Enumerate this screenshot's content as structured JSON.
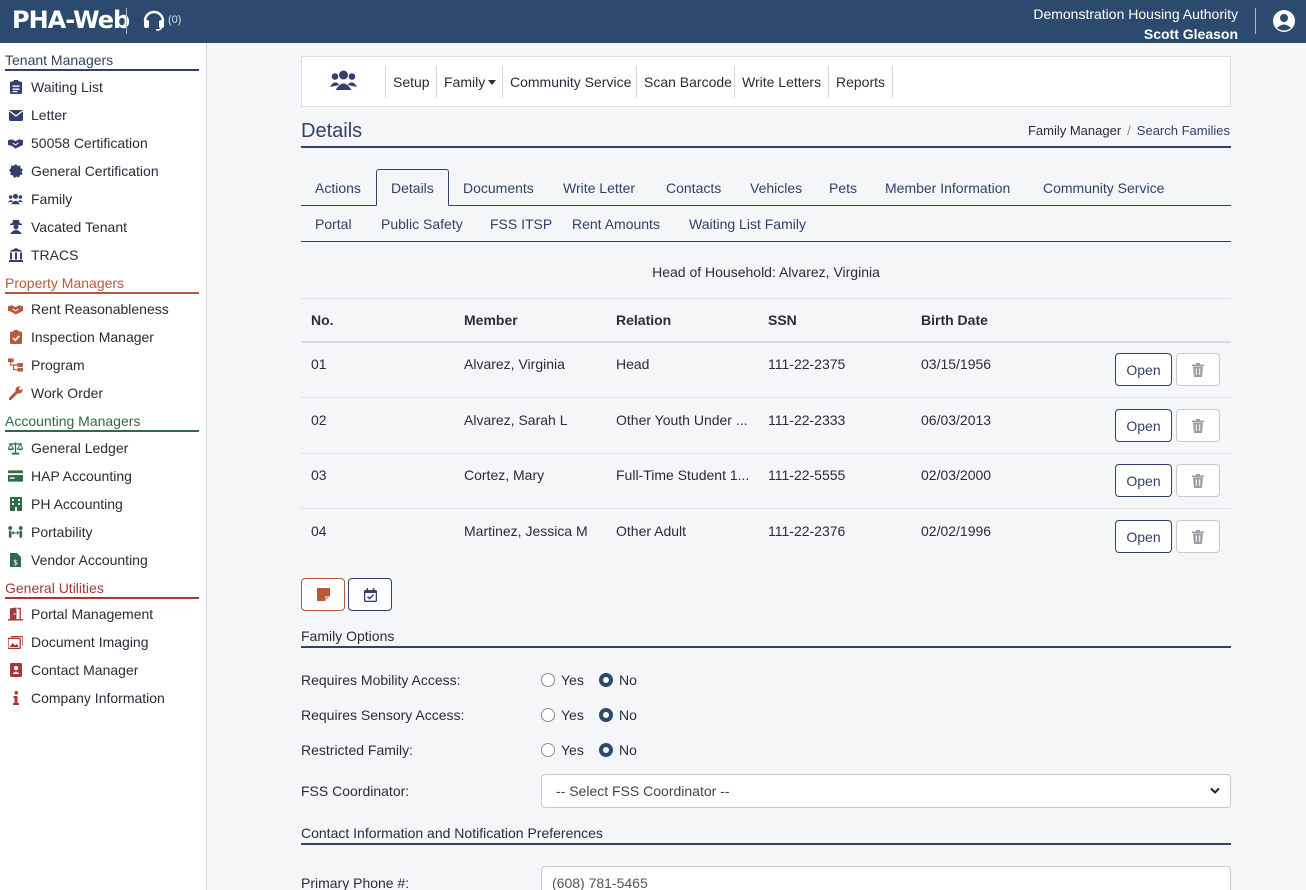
{
  "header": {
    "logo": "PHA-Web",
    "support_count": "(0)",
    "organization": "Demonstration Housing Authority",
    "user_name": "Scott Gleason"
  },
  "sidebar": {
    "sections": [
      {
        "title": "Tenant Managers",
        "items": [
          {
            "label": "Waiting List",
            "icon": "clipboard-list-icon"
          },
          {
            "label": "Letter",
            "icon": "envelope-icon"
          },
          {
            "label": "50058 Certification",
            "icon": "handshake-icon"
          },
          {
            "label": "General Certification",
            "icon": "certificate-icon"
          },
          {
            "label": "Family",
            "icon": "users-icon"
          },
          {
            "label": "Vacated Tenant",
            "icon": "user-secret-icon"
          },
          {
            "label": "TRACS",
            "icon": "landmark-icon"
          }
        ]
      },
      {
        "title": "Property Managers",
        "items": [
          {
            "label": "Rent Reasonableness",
            "icon": "handshake-icon"
          },
          {
            "label": "Inspection Manager",
            "icon": "clipboard-check-icon"
          },
          {
            "label": "Program",
            "icon": "sitemap-icon"
          },
          {
            "label": "Work Order",
            "icon": "wrench-icon"
          }
        ]
      },
      {
        "title": "Accounting Managers",
        "items": [
          {
            "label": "General Ledger",
            "icon": "balance-scale-icon"
          },
          {
            "label": "HAP Accounting",
            "icon": "money-bill-icon"
          },
          {
            "label": "PH Accounting",
            "icon": "building-icon"
          },
          {
            "label": "Portability",
            "icon": "people-arrows-icon"
          },
          {
            "label": "Vendor Accounting",
            "icon": "file-invoice-dollar-icon"
          }
        ]
      },
      {
        "title": "General Utilities",
        "items": [
          {
            "label": "Portal Management",
            "icon": "door-open-icon"
          },
          {
            "label": "Document Imaging",
            "icon": "images-icon"
          },
          {
            "label": "Contact Manager",
            "icon": "address-book-icon"
          },
          {
            "label": "Company Information",
            "icon": "info-icon"
          }
        ]
      }
    ]
  },
  "toolbar": {
    "icon": "users-icon",
    "items": [
      "Setup",
      "Family",
      "Community Service",
      "Scan Barcode",
      "Write Letters",
      "Reports"
    ]
  },
  "page": {
    "title": "Details",
    "breadcrumb": [
      "Family Manager",
      "Search Families"
    ]
  },
  "tabs": {
    "row1": [
      "Actions",
      "Details",
      "Documents",
      "Write Letter",
      "Contacts",
      "Vehicles",
      "Pets",
      "Member Information",
      "Community Service"
    ],
    "row2": [
      "Portal",
      "Public Safety",
      "FSS ITSP",
      "Rent Amounts",
      "Waiting List Family"
    ],
    "active": "Details"
  },
  "household": {
    "head_label": "Head of Household: Alvarez, Virginia",
    "columns": [
      "No.",
      "Member",
      "Relation",
      "SSN",
      "Birth Date"
    ],
    "open_label": "Open",
    "rows": [
      {
        "no": "01",
        "member": "Alvarez, Virginia",
        "relation": "Head",
        "ssn": "111-22-2375",
        "birth": "03/15/1956"
      },
      {
        "no": "02",
        "member": "Alvarez, Sarah L",
        "relation": "Other Youth Under ...",
        "ssn": "111-22-2333",
        "birth": "06/03/2013"
      },
      {
        "no": "03",
        "member": "Cortez, Mary",
        "relation": "Full-Time Student 1...",
        "ssn": "111-22-5555",
        "birth": "02/03/2000"
      },
      {
        "no": "04",
        "member": "Martinez, Jessica M",
        "relation": "Other Adult",
        "ssn": "111-22-2376",
        "birth": "02/02/1996"
      }
    ]
  },
  "family_options": {
    "title": "Family Options",
    "yes_label": "Yes",
    "no_label": "No",
    "options": [
      {
        "label": "Requires Mobility Access:",
        "selected": "No"
      },
      {
        "label": "Requires Sensory Access:",
        "selected": "No"
      },
      {
        "label": "Restricted Family:",
        "selected": "No"
      }
    ],
    "fss_label": "FSS Coordinator:",
    "fss_value": "-- Select FSS Coordinator --"
  },
  "contact": {
    "title": "Contact Information and Notification Preferences",
    "primary_phone_label": "Primary Phone #:",
    "primary_phone_value": "(608) 781-5465"
  },
  "colors": {
    "header_bg": "#2c4a6d",
    "accent": "#34406b",
    "tenant": "#34406b",
    "property": "#b55a3a",
    "accounting": "#2f6b47",
    "utilities": "#a63838"
  }
}
